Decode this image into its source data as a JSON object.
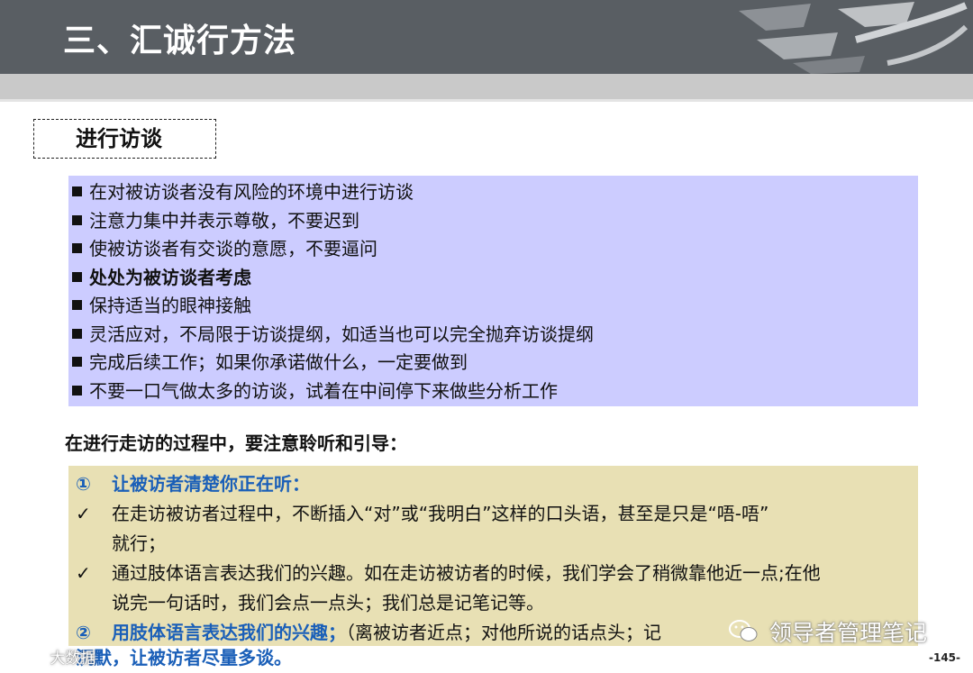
{
  "header": {
    "title": "三、汇诚行方法"
  },
  "section": {
    "title": "进行访谈"
  },
  "tips": [
    {
      "text": "在对被访谈者没有风险的环境中进行访谈",
      "bold": false
    },
    {
      "text": "注意力集中并表示尊敬，不要迟到",
      "bold": false
    },
    {
      "text": "使被访谈者有交谈的意愿，不要逼问",
      "bold": false
    },
    {
      "text": "处处为被访谈者考虑",
      "bold": true
    },
    {
      "text": "保持适当的眼神接触",
      "bold": false
    },
    {
      "text": "灵活应对，不局限于访谈提纲，如适当也可以完全抛弃访谈提纲",
      "bold": false
    },
    {
      "text": "完成后续工作；如果你承诺做什么，一定要做到",
      "bold": false
    },
    {
      "text": "不要一口气做太多的访谈，试着在中间停下来做些分析工作",
      "bold": false
    }
  ],
  "subheading": "在进行走访的过程中，要注意聆听和引导：",
  "guide": {
    "item1": {
      "num": "①",
      "text": "让被访者清楚你正在听："
    },
    "check1": {
      "mark": "✓",
      "line1": "在走访被访者过程中，不断插入“对”或“我明白”这样的口头语，甚至是只是“唔-唔”",
      "line2": "就行；"
    },
    "check2": {
      "mark": "✓",
      "line1": "通过肢体语言表达我们的兴趣。如在走访被访者的时候，我们学会了稍微靠他近一点;在他",
      "line2": "说完一句话时，我们会点一点头；我们总是记笔记等。"
    },
    "item2": {
      "num": "②",
      "head": "用肢体语言表达我们的兴趣；",
      "rest": "（离被访者近点；对他所说的话点头；记"
    },
    "item3": {
      "text": "沉默，让被访者尽量多谈。"
    }
  },
  "page_number": "-145-",
  "watermarks": {
    "left": "大数据",
    "right": "领导者管理笔记"
  },
  "colors": {
    "header_bg": "#595e63",
    "tips_bg": "#ccccff",
    "guide_bg": "#e8e0b4",
    "accent_blue": "#1a5fb8"
  }
}
